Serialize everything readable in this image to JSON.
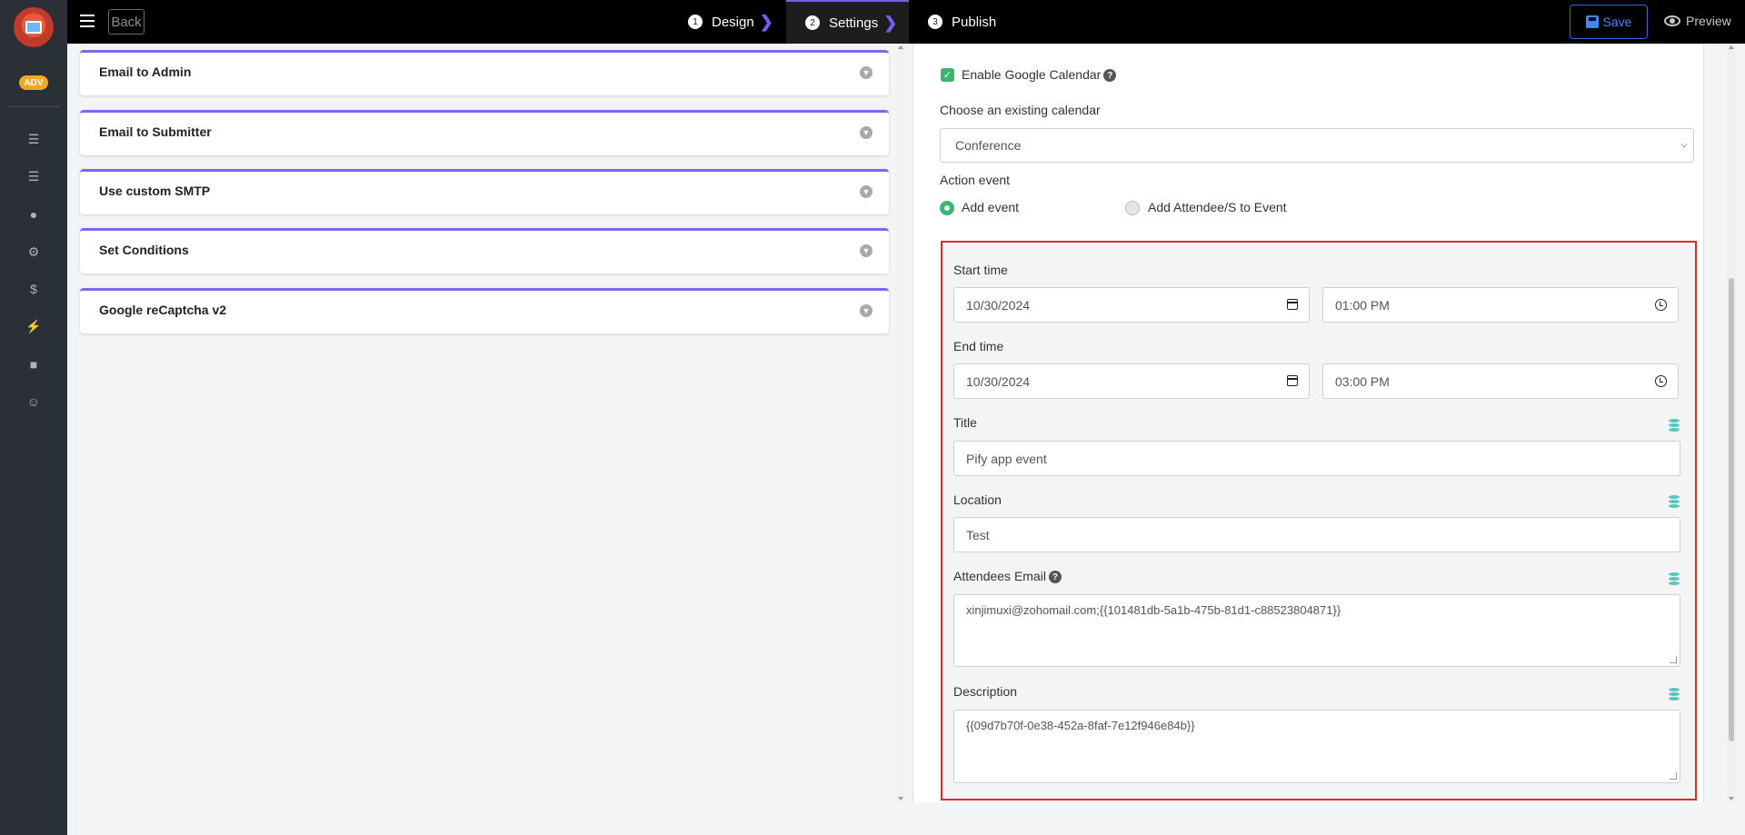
{
  "sidebar": {
    "badge": "ADV",
    "icons": [
      "list-icon",
      "checklist-icon",
      "user-icon",
      "gear-icon",
      "dollar-icon",
      "plug-icon",
      "document-icon",
      "smiley-icon"
    ]
  },
  "topbar": {
    "back_label": "Back",
    "steps": [
      {
        "num": "1",
        "label": "Design"
      },
      {
        "num": "2",
        "label": "Settings"
      },
      {
        "num": "3",
        "label": "Publish"
      }
    ],
    "save_label": "Save",
    "preview_label": "Preview"
  },
  "accordions": [
    {
      "title": "Email to Admin"
    },
    {
      "title": "Email to Submitter"
    },
    {
      "title": "Use custom SMTP"
    },
    {
      "title": "Set Conditions"
    },
    {
      "title": "Google reCaptcha v2"
    }
  ],
  "google_calendar": {
    "enable_label": "Enable Google Calendar",
    "choose_label": "Choose an existing calendar",
    "selected_calendar": "Conference",
    "action_label": "Action event",
    "action_options": [
      "Add event",
      "Add Attendee/S to Event"
    ],
    "start_label": "Start time",
    "start_date": "10/30/2024",
    "start_time": "01:00 PM",
    "end_label": "End time",
    "end_date": "10/30/2024",
    "end_time": "03:00 PM",
    "title_label": "Title",
    "title_value": "Pify app event",
    "location_label": "Location",
    "location_value": "Test",
    "attendees_label": "Attendees Email",
    "attendees_value": "xinjimuxi@zohomail.com;{{101481db-5a1b-475b-81d1-c88523804871}}",
    "description_label": "Description",
    "description_value": "{{09d7b70f-0e38-452a-8faf-7e12f946e84b}}"
  },
  "colors": {
    "accent": "#7b68ee",
    "success": "#3bb56b",
    "highlight_border": "#d32f2f",
    "save_blue": "#3f86ff"
  }
}
